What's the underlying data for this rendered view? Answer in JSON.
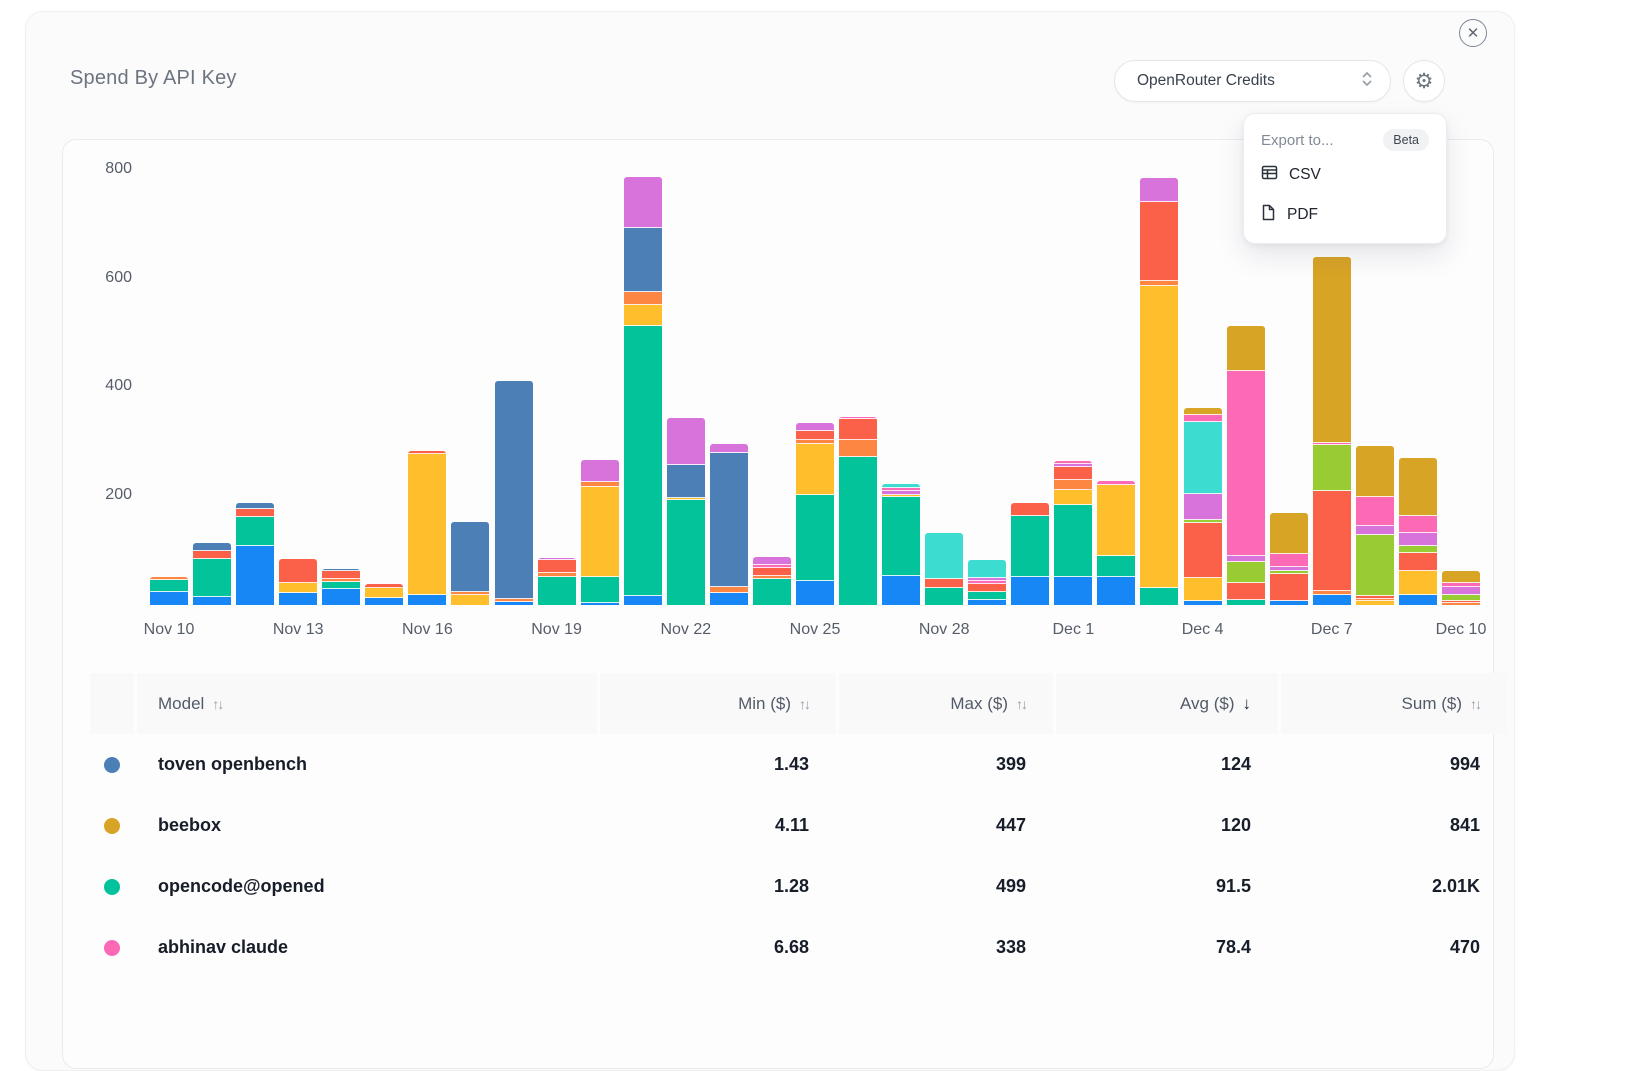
{
  "window": {
    "close_glyph": "✕"
  },
  "header": {
    "title": "Spend By API Key",
    "currency_select": {
      "value": "OpenRouter Credits"
    }
  },
  "export_menu": {
    "label": "Export to...",
    "badge": "Beta",
    "items": [
      {
        "label": "CSV",
        "icon": "table-icon"
      },
      {
        "label": "PDF",
        "icon": "file-icon"
      }
    ]
  },
  "chart_data": {
    "type": "bar",
    "stacked": true,
    "title": "Spend By API Key",
    "xlabel": "",
    "ylabel": "",
    "ylim": [
      0,
      860
    ],
    "grid": false,
    "legend_position": "none",
    "y_ticks": [
      {
        "label": "200",
        "value": 200
      },
      {
        "label": "400",
        "value": 400
      },
      {
        "label": "600",
        "value": 600
      },
      {
        "label": "800",
        "value": 800
      }
    ],
    "x_tick_labels": [
      "Nov 10",
      "Nov 13",
      "Nov 16",
      "Nov 19",
      "Nov 22",
      "Nov 25",
      "Nov 28",
      "Dec 1",
      "Dec 4",
      "Dec 7",
      "Dec 10"
    ],
    "series_colors": {
      "blue": "#1787f5",
      "teal": "#02c39a",
      "amber": "#ffbe2b",
      "orange": "#fd8643",
      "tomato": "#fb6148",
      "steel": "#4b7fb5",
      "orchid": "#d873dc",
      "turquoise": "#3ddcd1",
      "pink": "#fc69b5",
      "lime": "#99cc33",
      "gold": "#d8a426"
    },
    "named_series": {
      "steel": "toven openbench",
      "gold": "beebox",
      "teal": "opencode@opened",
      "pink": "abhinav claude"
    },
    "bars": [
      {
        "date": "Nov 10",
        "segments": [
          [
            "blue",
            24
          ],
          [
            "teal",
            22
          ],
          [
            "orange",
            5
          ]
        ]
      },
      {
        "date": "Nov 11",
        "segments": [
          [
            "blue",
            15
          ],
          [
            "teal",
            70
          ],
          [
            "tomato",
            15
          ],
          [
            "steel",
            14
          ]
        ]
      },
      {
        "date": "Nov 12",
        "segments": [
          [
            "blue",
            108
          ],
          [
            "teal",
            53
          ],
          [
            "tomato",
            14
          ],
          [
            "steel",
            11
          ]
        ]
      },
      {
        "date": "Nov 13",
        "segments": [
          [
            "blue",
            22
          ],
          [
            "amber",
            18
          ],
          [
            "tomato",
            45
          ]
        ]
      },
      {
        "date": "Nov 14",
        "segments": [
          [
            "blue",
            29
          ],
          [
            "teal",
            13
          ],
          [
            "orange",
            5
          ],
          [
            "tomato",
            14
          ],
          [
            "steel",
            4
          ]
        ]
      },
      {
        "date": "Nov 15",
        "segments": [
          [
            "blue",
            13
          ],
          [
            "amber",
            18
          ],
          [
            "tomato",
            7
          ]
        ]
      },
      {
        "date": "Nov 16",
        "segments": [
          [
            "blue",
            19
          ],
          [
            "amber",
            260
          ],
          [
            "tomato",
            5
          ]
        ]
      },
      {
        "date": "Nov 17",
        "segments": [
          [
            "amber",
            18
          ],
          [
            "orange",
            5
          ],
          [
            "steel",
            129
          ]
        ]
      },
      {
        "date": "Nov 18",
        "segments": [
          [
            "blue",
            6
          ],
          [
            "orange",
            6
          ],
          [
            "steel",
            400
          ]
        ]
      },
      {
        "date": "Nov 19",
        "segments": [
          [
            "teal",
            52
          ],
          [
            "orange",
            7
          ],
          [
            "tomato",
            24
          ],
          [
            "orchid",
            4
          ]
        ]
      },
      {
        "date": "Nov 20",
        "segments": [
          [
            "blue",
            2
          ],
          [
            "teal",
            48
          ],
          [
            "amber",
            166
          ],
          [
            "orange",
            9
          ],
          [
            "orchid",
            41
          ]
        ]
      },
      {
        "date": "Nov 21",
        "segments": [
          [
            "blue",
            16
          ],
          [
            "teal",
            496
          ],
          [
            "amber",
            39
          ],
          [
            "orange",
            23
          ],
          [
            "steel",
            118
          ],
          [
            "orchid",
            94
          ]
        ]
      },
      {
        "date": "Nov 22",
        "segments": [
          [
            "teal",
            193
          ],
          [
            "amber",
            4
          ],
          [
            "steel",
            60
          ],
          [
            "orchid",
            87
          ]
        ]
      },
      {
        "date": "Nov 23",
        "segments": [
          [
            "blue",
            22
          ],
          [
            "orange",
            11
          ],
          [
            "steel",
            247
          ],
          [
            "orchid",
            16
          ]
        ]
      },
      {
        "date": "Nov 24",
        "segments": [
          [
            "teal",
            48
          ],
          [
            "orange",
            5
          ],
          [
            "tomato",
            15
          ],
          [
            "pink",
            5
          ],
          [
            "orchid",
            14
          ]
        ]
      },
      {
        "date": "Nov 25",
        "segments": [
          [
            "blue",
            44
          ],
          [
            "teal",
            158
          ],
          [
            "amber",
            93
          ],
          [
            "orange",
            7
          ],
          [
            "tomato",
            17
          ],
          [
            "orchid",
            15
          ]
        ]
      },
      {
        "date": "Nov 26",
        "segments": [
          [
            "teal",
            272
          ],
          [
            "orange",
            32
          ],
          [
            "tomato",
            39
          ],
          [
            "pink",
            3
          ]
        ]
      },
      {
        "date": "Nov 27",
        "segments": [
          [
            "blue",
            53
          ],
          [
            "teal",
            146
          ],
          [
            "amber",
            4
          ],
          [
            "orchid",
            8
          ],
          [
            "pink",
            6
          ],
          [
            "turquoise",
            7
          ]
        ]
      },
      {
        "date": "Nov 28",
        "segments": [
          [
            "teal",
            31
          ],
          [
            "tomato",
            17
          ],
          [
            "turquoise",
            85
          ]
        ]
      },
      {
        "date": "Nov 29",
        "segments": [
          [
            "blue",
            10
          ],
          [
            "teal",
            15
          ],
          [
            "tomato",
            14
          ],
          [
            "pink",
            5
          ],
          [
            "orchid",
            6
          ],
          [
            "turquoise",
            34
          ]
        ]
      },
      {
        "date": "Nov 30",
        "segments": [
          [
            "blue",
            51
          ],
          [
            "teal",
            113
          ],
          [
            "tomato",
            23
          ]
        ]
      },
      {
        "date": "Dec 1",
        "segments": [
          [
            "blue",
            51
          ],
          [
            "teal",
            132
          ],
          [
            "amber",
            27
          ],
          [
            "orange",
            18
          ],
          [
            "tomato",
            24
          ],
          [
            "orchid",
            5
          ],
          [
            "pink",
            6
          ]
        ]
      },
      {
        "date": "Dec 2",
        "segments": [
          [
            "blue",
            51
          ],
          [
            "teal",
            38
          ],
          [
            "amber",
            130
          ],
          [
            "pink",
            8
          ]
        ]
      },
      {
        "date": "Dec 3",
        "segments": [
          [
            "teal",
            31
          ],
          [
            "amber",
            555
          ],
          [
            "orange",
            10
          ],
          [
            "tomato",
            145
          ],
          [
            "orchid",
            45
          ]
        ]
      },
      {
        "date": "Dec 4",
        "segments": [
          [
            "blue",
            8
          ],
          [
            "amber",
            42
          ],
          [
            "tomato",
            101
          ],
          [
            "lime",
            5
          ],
          [
            "orchid",
            47
          ],
          [
            "turquoise",
            132
          ],
          [
            "pink",
            13
          ],
          [
            "gold",
            12
          ]
        ]
      },
      {
        "date": "Dec 5",
        "segments": [
          [
            "teal",
            9
          ],
          [
            "tomato",
            32
          ],
          [
            "lime",
            39
          ],
          [
            "orchid",
            11
          ],
          [
            "pink",
            340
          ],
          [
            "gold",
            83
          ]
        ]
      },
      {
        "date": "Dec 6",
        "segments": [
          [
            "blue",
            7
          ],
          [
            "tomato",
            49
          ],
          [
            "lime",
            5
          ],
          [
            "orchid",
            7
          ],
          [
            "pink",
            24
          ],
          [
            "gold",
            75
          ]
        ]
      },
      {
        "date": "Dec 7",
        "segments": [
          [
            "blue",
            18
          ],
          [
            "orange",
            7
          ],
          [
            "tomato",
            184
          ],
          [
            "lime",
            85
          ],
          [
            "pink",
            4
          ],
          [
            "gold",
            342
          ]
        ]
      },
      {
        "date": "Dec 8",
        "segments": [
          [
            "amber",
            7
          ],
          [
            "orange",
            4
          ],
          [
            "tomato",
            6
          ],
          [
            "lime",
            113
          ],
          [
            "orchid",
            16
          ],
          [
            "pink",
            53
          ],
          [
            "gold",
            93
          ]
        ]
      },
      {
        "date": "Dec 9",
        "segments": [
          [
            "blue",
            18
          ],
          [
            "amber",
            45
          ],
          [
            "tomato",
            33
          ],
          [
            "lime",
            13
          ],
          [
            "orchid",
            24
          ],
          [
            "pink",
            31
          ],
          [
            "gold",
            107
          ]
        ]
      },
      {
        "date": "Dec 10",
        "segments": [
          [
            "orange",
            2
          ],
          [
            "tomato",
            4
          ],
          [
            "lime",
            11
          ],
          [
            "orchid",
            15
          ],
          [
            "pink",
            7
          ],
          [
            "gold",
            22
          ]
        ]
      }
    ]
  },
  "table": {
    "columns": [
      {
        "label": "Model",
        "sort_icon": "↑↓",
        "active": false
      },
      {
        "label": "Min ($)",
        "sort_icon": "↑↓",
        "active": false
      },
      {
        "label": "Max ($)",
        "sort_icon": "↑↓",
        "active": false
      },
      {
        "label": "Avg ($)",
        "sort_icon": "↓",
        "active": true
      },
      {
        "label": "Sum ($)",
        "sort_icon": "↑↓",
        "active": false
      }
    ],
    "rows": [
      {
        "dot_color": "#4b7fb5",
        "model": "toven openbench",
        "min": "1.43",
        "max": "399",
        "avg": "124",
        "sum": "994"
      },
      {
        "dot_color": "#d8a426",
        "model": "beebox",
        "min": "4.11",
        "max": "447",
        "avg": "120",
        "sum": "841"
      },
      {
        "dot_color": "#02c39a",
        "model": "opencode@opened",
        "min": "1.28",
        "max": "499",
        "avg": "91.5",
        "sum": "2.01K"
      },
      {
        "dot_color": "#fc69b5",
        "model": "abhinav claude",
        "min": "6.68",
        "max": "338",
        "avg": "78.4",
        "sum": "470"
      }
    ]
  }
}
